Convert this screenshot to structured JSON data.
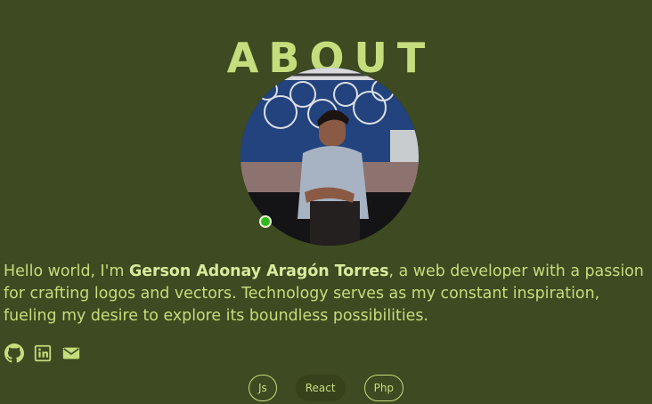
{
  "about": {
    "title": "ABOUT",
    "avatar_alt": "Profile photo",
    "bio_intro": "Hello world, I'm ",
    "bio_name": "Gerson Adonay Aragón Torres",
    "bio_rest": ", a web developer with a passion for crafting logos and vectors. Technology serves as my constant inspiration, fueling my desire to explore its boundless possibilities."
  },
  "socials": [
    {
      "icon": "github-icon"
    },
    {
      "icon": "linkedin-icon"
    },
    {
      "icon": "email-icon"
    }
  ],
  "skills": [
    "Js",
    "React",
    "Php"
  ],
  "colors": {
    "background": "#3e4a21",
    "accent": "#c5dd7c",
    "status_online": "#32b81f"
  }
}
